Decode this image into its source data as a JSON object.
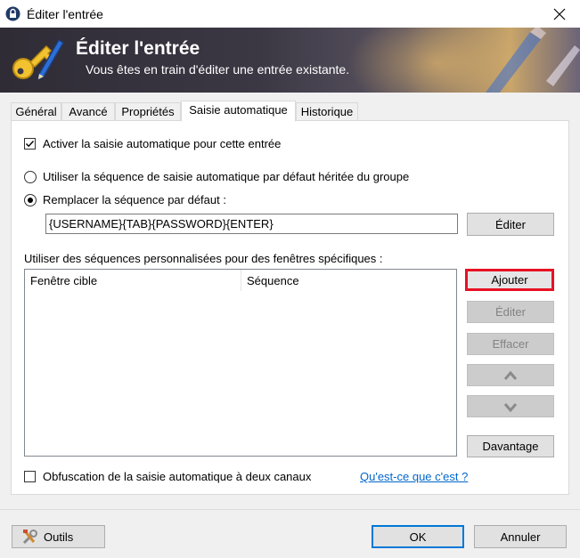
{
  "window": {
    "title": "Éditer l'entrée",
    "icons": {
      "app": "lock-icon",
      "close": "close-icon"
    }
  },
  "banner": {
    "title": "Éditer l'entrée",
    "subtitle": "Vous êtes en train d'éditer une entrée existante.",
    "icons": {
      "main": "key-pencil-icon",
      "decoration": "pencil-decoration-icon"
    }
  },
  "tabs": [
    {
      "label": "Général",
      "active": false
    },
    {
      "label": "Avancé",
      "active": false
    },
    {
      "label": "Propriétés",
      "active": false
    },
    {
      "label": "Saisie automatique",
      "active": true
    },
    {
      "label": "Historique",
      "active": false
    }
  ],
  "autotype": {
    "enable_label": "Activer la saisie automatique pour cette entrée",
    "enable_checked": true,
    "inherit_label": "Utiliser la séquence de saisie automatique par défaut héritée du groupe",
    "inherit_selected": false,
    "override_label": "Remplacer la séquence par défaut :",
    "override_selected": true,
    "sequence_value": "{USERNAME}{TAB}{PASSWORD}{ENTER}",
    "edit_sequence_label": "Éditer",
    "custom_label": "Utiliser des séquences personnalisées pour des fenêtres spécifiques :",
    "columns": [
      "Fenêtre cible",
      "Séquence"
    ],
    "rows": [],
    "buttons": {
      "add": "Ajouter",
      "edit": "Éditer",
      "delete": "Effacer",
      "up_icon": "chevron-up-icon",
      "down_icon": "chevron-down-icon",
      "more": "Davantage"
    },
    "obfuscation_label": "Obfuscation de la saisie automatique à deux canaux",
    "obfuscation_checked": false,
    "help_link": "Qu'est-ce que c'est ?"
  },
  "footer": {
    "tools_label": "Outils",
    "tools_icon": "tools-icon",
    "ok_label": "OK",
    "cancel_label": "Annuler"
  },
  "colors": {
    "highlight_border": "#e81123",
    "link": "#0066cc",
    "default_button_border": "#0078d7"
  }
}
